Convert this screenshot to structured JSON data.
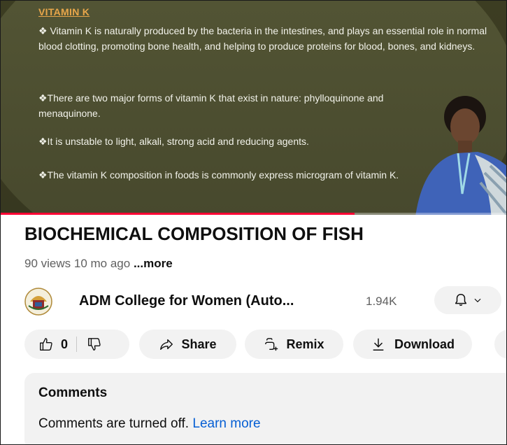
{
  "video": {
    "slide_title": "VITAMIN K",
    "paragraphs": [
      "❖ Vitamin K is naturally produced by the bacteria in the intestines, and plays an essential role in normal blood clotting, promoting bone health, and helping to produce proteins for blood, bones, and kidneys.",
      "❖There are two major forms of vitamin K that exist in nature: phylloquinone and menaquinone.",
      "❖It is unstable to light, alkali, strong acid and reducing agents.",
      "❖The vitamin K composition in foods is commonly express microgram of vitamin K."
    ],
    "progress_percent": 70
  },
  "title": "BIOCHEMICAL COMPOSITION OF FISH",
  "meta": {
    "views": "90 views",
    "age": "10 mo ago",
    "more": "...more"
  },
  "channel": {
    "name": "ADM College for Women (Auto...",
    "subscribers": "1.94K"
  },
  "actions": {
    "like_count": "0",
    "share": "Share",
    "remix": "Remix",
    "download": "Download"
  },
  "comments": {
    "title": "Comments",
    "message": "Comments are turned off.",
    "learn_more": "Learn more"
  },
  "colors": {
    "slide_bg": "#525434",
    "slide_title": "#e8a64a",
    "progress": "#ff0033",
    "link": "#065fd4"
  }
}
